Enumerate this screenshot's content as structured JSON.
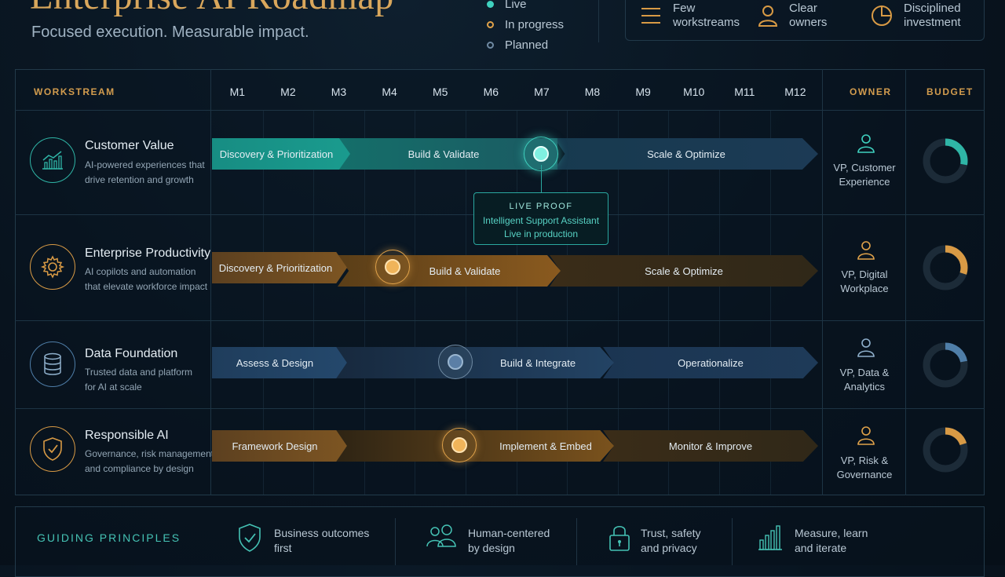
{
  "header": {
    "title": "Enterprise AI Roadmap",
    "subtitle": "Focused execution. Measurable impact."
  },
  "legend": [
    {
      "label": "Live",
      "color": "#3fd1bf"
    },
    {
      "label": "In progress",
      "color": "#e0a24a"
    },
    {
      "label": "Planned",
      "color": "#6f8aa3"
    }
  ],
  "features": [
    {
      "label": "Few workstreams",
      "icon": "list-icon"
    },
    {
      "label": "Clear owners",
      "icon": "person-icon"
    },
    {
      "label": "Disciplined investment",
      "icon": "pie-chart-icon"
    }
  ],
  "table": {
    "col_workstream": "WORKSTREAM",
    "col_owner": "OWNER",
    "col_budget": "BUDGET",
    "months": [
      "M1",
      "M2",
      "M3",
      "M4",
      "M5",
      "M6",
      "M7",
      "M8",
      "M9",
      "M10",
      "M11",
      "M12"
    ]
  },
  "colors": {
    "teal": "#2fb5a6",
    "amber": "#d89a45",
    "blue": "#4f7ea8"
  },
  "workstreams": [
    {
      "name": "Customer Value",
      "desc": [
        "AI-powered experiences that",
        "drive retention and growth"
      ],
      "icon": "growth-chart-icon",
      "phases": [
        "Discovery & Prioritization",
        "Build & Validate",
        "Scale & Optimize"
      ],
      "owner": [
        "VP, Customer",
        "Experience"
      ],
      "budget_share": 0.28
    },
    {
      "name": "Enterprise Productivity",
      "desc": [
        "AI copilots and automation",
        "that elevate workforce impact"
      ],
      "icon": "gear-icon",
      "phases": [
        "Discovery & Prioritization",
        "Build & Validate",
        "Scale & Optimize"
      ],
      "owner": [
        "VP, Digital",
        "Workplace"
      ],
      "budget_share": 0.3
    },
    {
      "name": "Data Foundation",
      "desc": [
        "Trusted data and platform",
        "for AI at scale"
      ],
      "icon": "database-icon",
      "phases": [
        "Assess & Design",
        "Build & Integrate",
        "Operationalize"
      ],
      "owner": [
        "VP, Data &",
        "Analytics"
      ],
      "budget_share": 0.22
    },
    {
      "name": "Responsible AI",
      "desc": [
        "Governance, risk management",
        "and compliance by design"
      ],
      "icon": "shield-check-icon",
      "phases": [
        "Framework Design",
        "Implement & Embed",
        "Monitor & Improve"
      ],
      "owner": [
        "VP, Risk &",
        "Governance"
      ],
      "budget_share": 0.2
    }
  ],
  "callout": {
    "label": "LIVE PROOF",
    "title": "Intelligent Support Assistant",
    "status": "Live in production"
  },
  "principles": {
    "title": "GUIDING PRINCIPLES",
    "items": [
      {
        "label": "Business outcomes first",
        "icon": "shield-check-icon"
      },
      {
        "label": "Human-centered by design",
        "icon": "people-icon"
      },
      {
        "label": "Trust, safety and privacy",
        "icon": "lock-icon"
      },
      {
        "label": "Measure, learn and iterate",
        "icon": "bar-chart-icon"
      }
    ]
  }
}
